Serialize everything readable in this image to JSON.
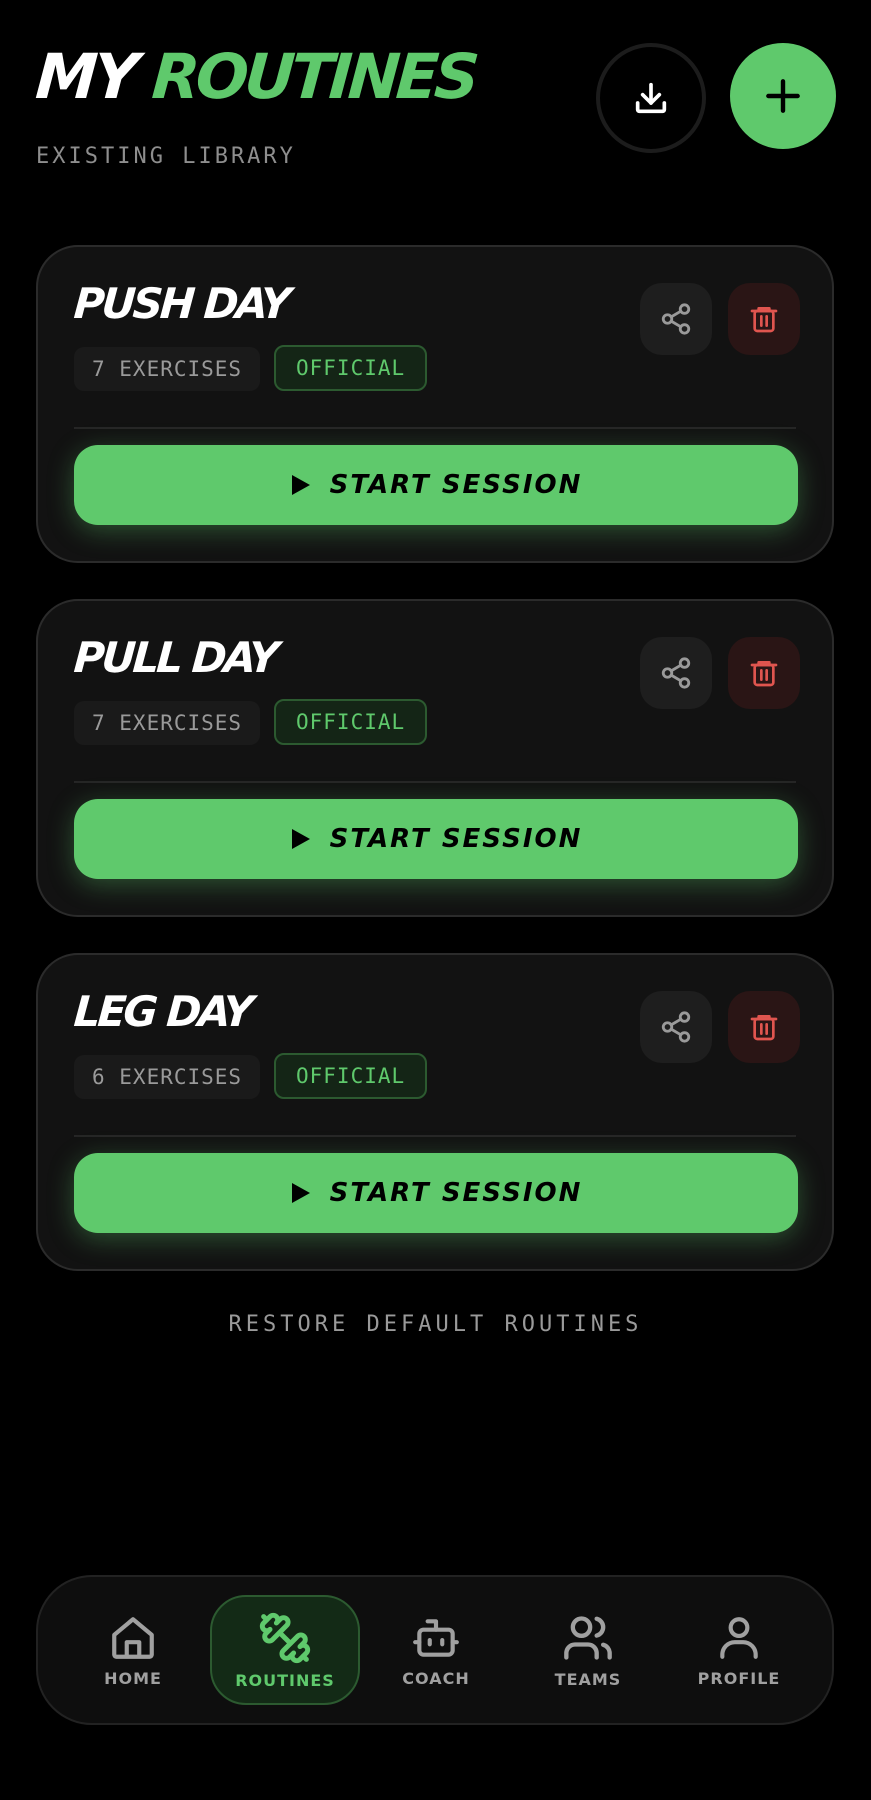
{
  "header": {
    "title_part1": "MY",
    "title_part2": "ROUTINES",
    "subtitle": "EXISTING LIBRARY",
    "import_icon": "download-icon",
    "add_icon": "plus-icon"
  },
  "routines": [
    {
      "name": "PUSH DAY",
      "exercises": "7 EXERCISES",
      "badge": "OFFICIAL",
      "start_label": "START SESSION"
    },
    {
      "name": "PULL DAY",
      "exercises": "7 EXERCISES",
      "badge": "OFFICIAL",
      "start_label": "START SESSION"
    },
    {
      "name": "LEG DAY",
      "exercises": "6 EXERCISES",
      "badge": "OFFICIAL",
      "start_label": "START SESSION"
    }
  ],
  "restore_label": "RESTORE DEFAULT ROUTINES",
  "nav": {
    "items": [
      {
        "label": "HOME",
        "icon": "home-icon"
      },
      {
        "label": "ROUTINES",
        "icon": "dumbbell-icon",
        "active": true
      },
      {
        "label": "COACH",
        "icon": "robot-icon"
      },
      {
        "label": "TEAMS",
        "icon": "users-icon"
      },
      {
        "label": "PROFILE",
        "icon": "user-icon"
      }
    ]
  },
  "colors": {
    "accent": "#5fc96c",
    "danger": "#e0554f",
    "background": "#000000",
    "card": "#121212"
  }
}
